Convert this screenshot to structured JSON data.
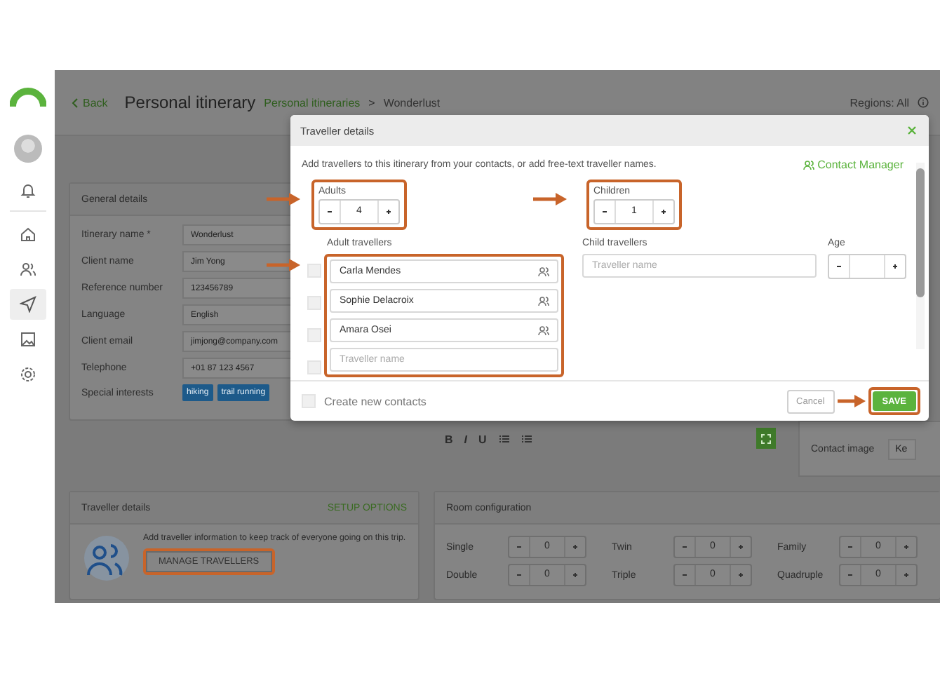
{
  "sidebar": {
    "items": [
      {
        "selected": false
      },
      {
        "selected": false
      },
      {
        "selected": true
      },
      {
        "selected": false
      },
      {
        "selected": false
      }
    ]
  },
  "header": {
    "back": "Back",
    "title": "Personal itinerary",
    "breadcrumb": [
      {
        "label": "Personal itineraries",
        "kind": "link"
      },
      {
        "label": "Wonderlust",
        "kind": "current"
      }
    ],
    "separator": ">",
    "regions": "Regions: All"
  },
  "general_details": {
    "title": "General details",
    "fields": [
      {
        "label": "Itinerary name *",
        "value": "Wonderlust"
      },
      {
        "label": "Client name",
        "value": "Jim Yong"
      },
      {
        "label": "Reference number",
        "value": "123456789"
      },
      {
        "label": "Language",
        "value": "English"
      },
      {
        "label": "Client email",
        "value": "jimjong@company.com"
      },
      {
        "label": "Telephone",
        "value": "+01 87 123 4567"
      }
    ],
    "interests": {
      "label": "Special interests",
      "tags": [
        "hiking",
        "trail running"
      ]
    }
  },
  "editor": {
    "tools": [
      "B",
      "I",
      "U"
    ]
  },
  "contact_image": {
    "label": "Contact image",
    "value": "Ke"
  },
  "traveller_card": {
    "title": "Traveller details",
    "action": "SETUP OPTIONS",
    "text": "Add traveller information to keep track of everyone going on this trip.",
    "button": "MANAGE TRAVELLERS"
  },
  "room_config": {
    "title": "Room configuration",
    "rooms": [
      {
        "label": "Single",
        "value": "0"
      },
      {
        "label": "Twin",
        "value": "0"
      },
      {
        "label": "Family",
        "value": "0"
      },
      {
        "label": "Double",
        "value": "0"
      },
      {
        "label": "Triple",
        "value": "0"
      },
      {
        "label": "Quadruple",
        "value": "0"
      }
    ]
  },
  "modal": {
    "title": "Traveller details",
    "intro": "Add travellers to this itinerary from your contacts, or add free-text traveller names.",
    "contact_manager": "Contact Manager",
    "adults": {
      "label": "Adults",
      "value": "4"
    },
    "children": {
      "label": "Children",
      "value": "1"
    },
    "adult_travellers": {
      "label": "Adult travellers",
      "rows": [
        {
          "kind": "contact",
          "name": "Carla Mendes",
          "checked": false
        },
        {
          "kind": "contact",
          "name": "Sophie Delacroix",
          "checked": false
        },
        {
          "kind": "contact",
          "name": "Amara Osei",
          "checked": false
        },
        {
          "kind": "empty",
          "placeholder": "Traveller name",
          "checked": false
        }
      ]
    },
    "child_travellers": {
      "label": "Child travellers",
      "placeholder": "Traveller name"
    },
    "age": {
      "label": "Age"
    },
    "create_contacts": {
      "label": "Create new contacts",
      "checked": false
    },
    "cancel": "Cancel",
    "save": "SAVE"
  }
}
